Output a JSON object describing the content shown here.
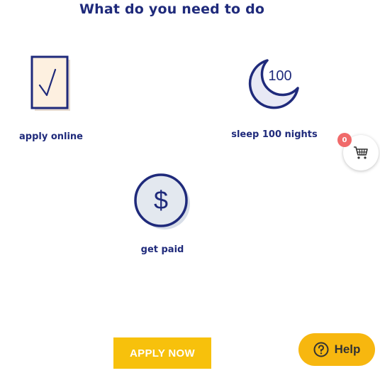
{
  "page": {
    "title": "What do you need to do"
  },
  "steps": [
    {
      "label": "apply online",
      "icon": "checklist-icon"
    },
    {
      "label": "sleep 100 nights",
      "icon": "moon-100-icon",
      "icon_text": "100"
    },
    {
      "label": "get paid",
      "icon": "dollar-coin-icon",
      "icon_text": "$"
    }
  ],
  "cart": {
    "count": "0",
    "icon": "cart-icon"
  },
  "cta": {
    "apply_label": "APPLY NOW"
  },
  "help": {
    "label": "Help",
    "icon": "question-circle-icon"
  },
  "colors": {
    "navy": "#1f2a7b",
    "accent_yellow": "#f7c10c",
    "badge_red": "#f06a6a",
    "icon_fill": "#fdf0e0",
    "coin_fill": "#e3e8ef"
  }
}
